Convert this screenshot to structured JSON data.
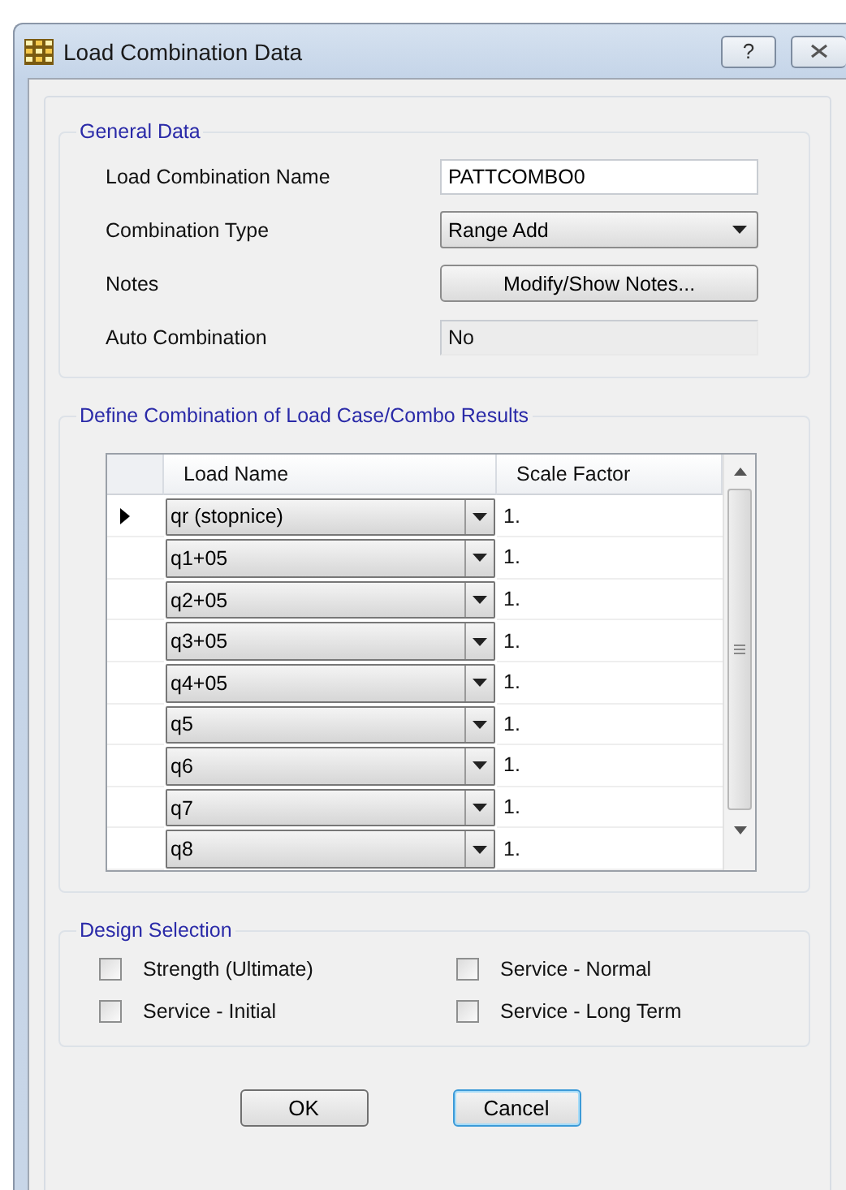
{
  "window": {
    "title": "Load Combination Data",
    "help": "?"
  },
  "general_data": {
    "title": "General Data",
    "fields": [
      {
        "label": "Load Combination Name",
        "kind": "text",
        "value": "PATTCOMBO0"
      },
      {
        "label": "Combination Type",
        "kind": "dropdown",
        "value": "Range Add"
      },
      {
        "label": "Notes",
        "kind": "button",
        "value": "Modify/Show Notes..."
      },
      {
        "label": "Auto Combination",
        "kind": "readonly",
        "value": "No"
      }
    ]
  },
  "combination": {
    "title": "Define Combination of Load Case/Combo Results",
    "columns": [
      "Load Name",
      "Scale Factor"
    ],
    "rows": [
      {
        "load_name": "qr (stopnice)",
        "scale_factor": "1.",
        "current": true
      },
      {
        "load_name": "q1+05",
        "scale_factor": "1.",
        "current": false
      },
      {
        "load_name": "q2+05",
        "scale_factor": "1.",
        "current": false
      },
      {
        "load_name": "q3+05",
        "scale_factor": "1.",
        "current": false
      },
      {
        "load_name": "q4+05",
        "scale_factor": "1.",
        "current": false
      },
      {
        "load_name": "q5",
        "scale_factor": "1.",
        "current": false
      },
      {
        "load_name": "q6",
        "scale_factor": "1.",
        "current": false
      },
      {
        "load_name": "q7",
        "scale_factor": "1.",
        "current": false
      },
      {
        "load_name": "q8",
        "scale_factor": "1.",
        "current": false
      }
    ]
  },
  "design_selection": {
    "title": "Design Selection",
    "options": [
      {
        "label": "Strength (Ultimate)",
        "checked": false
      },
      {
        "label": "Service - Normal",
        "checked": false
      },
      {
        "label": "Service - Initial",
        "checked": false
      },
      {
        "label": "Service - Long Term",
        "checked": false
      }
    ]
  },
  "buttons": [
    {
      "label": "OK",
      "focused": false
    },
    {
      "label": "Cancel",
      "focused": true
    }
  ]
}
